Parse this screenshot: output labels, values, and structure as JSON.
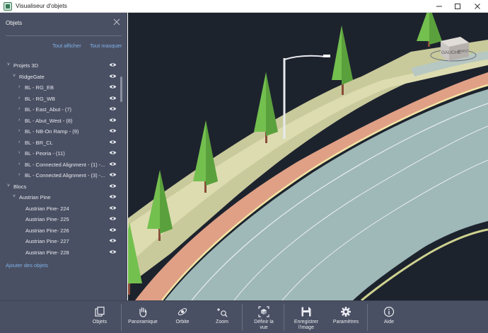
{
  "window": {
    "title": "Visualiseur d'objets"
  },
  "panel": {
    "title": "Objets",
    "show_all": "Tout afficher",
    "hide_all": "Tout masquer",
    "add_objects": "Ajouter des objets",
    "tree": [
      {
        "label": "Projets 3D",
        "level": 0,
        "expander": "down"
      },
      {
        "label": "RidgeGate",
        "level": 1,
        "expander": "down"
      },
      {
        "label": "BL - RG_EB",
        "level": 2,
        "expander": "right"
      },
      {
        "label": "BL - RG_WB",
        "level": 2,
        "expander": "right"
      },
      {
        "label": "BL - East_Abut - (7)",
        "level": 2,
        "expander": "right"
      },
      {
        "label": "BL - Abut_West - (8)",
        "level": 2,
        "expander": "right"
      },
      {
        "label": "BL - NB-On Ramp - (9)",
        "level": 2,
        "expander": "right"
      },
      {
        "label": "BL - BR_CL",
        "level": 2,
        "expander": "right"
      },
      {
        "label": "BL - Peoria - (11)",
        "level": 2,
        "expander": "right"
      },
      {
        "label": "BL - Connected Alignment - (1) -...",
        "level": 2,
        "expander": "right"
      },
      {
        "label": "BL - Connected Alignment - (3) -...",
        "level": 2,
        "expander": "right"
      },
      {
        "label": "Blocs",
        "level": 0,
        "expander": "down"
      },
      {
        "label": "Austrian Pine",
        "level": 1,
        "expander": "down"
      },
      {
        "label": "Austrian Pine- 224",
        "level": 2,
        "expander": "none"
      },
      {
        "label": "Austrian Pine- 225",
        "level": 2,
        "expander": "none"
      },
      {
        "label": "Austrian Pine- 226",
        "level": 2,
        "expander": "none"
      },
      {
        "label": "Austrian Pine- 227",
        "level": 2,
        "expander": "none"
      },
      {
        "label": "Austrian Pine- 228",
        "level": 2,
        "expander": "none"
      }
    ]
  },
  "viewcube": {
    "face_label": "GAUCHE",
    "side_label": "AVANT"
  },
  "toolbar": {
    "items": [
      {
        "key": "objets",
        "label": "Objets",
        "icon": "objects-icon"
      },
      {
        "key": "panoramique",
        "label": "Panoramique",
        "icon": "pan-hand-icon"
      },
      {
        "key": "orbite",
        "label": "Orbite",
        "icon": "orbit-icon"
      },
      {
        "key": "zoom",
        "label": "Zoom",
        "icon": "zoom-icon"
      },
      {
        "key": "definir_vue",
        "label": "Définir la vue",
        "icon": "set-view-icon"
      },
      {
        "key": "enregistrer_image",
        "label": "Enregistrer l'image",
        "icon": "save-image-icon"
      },
      {
        "key": "parametres",
        "label": "Paramètres",
        "icon": "gear-icon"
      },
      {
        "key": "aide",
        "label": "Aide",
        "icon": "info-icon"
      }
    ]
  },
  "colors": {
    "panel_bg": "#4a5063",
    "viewport_bg": "#1d232d",
    "link": "#7fb2ea",
    "road_surface": "#9fb8b8",
    "bike_lane": "#e0a086",
    "terrain": "#c9ca9b",
    "tree_foliage": "#74c04f",
    "tree_trunk": "#8a4c3a"
  }
}
